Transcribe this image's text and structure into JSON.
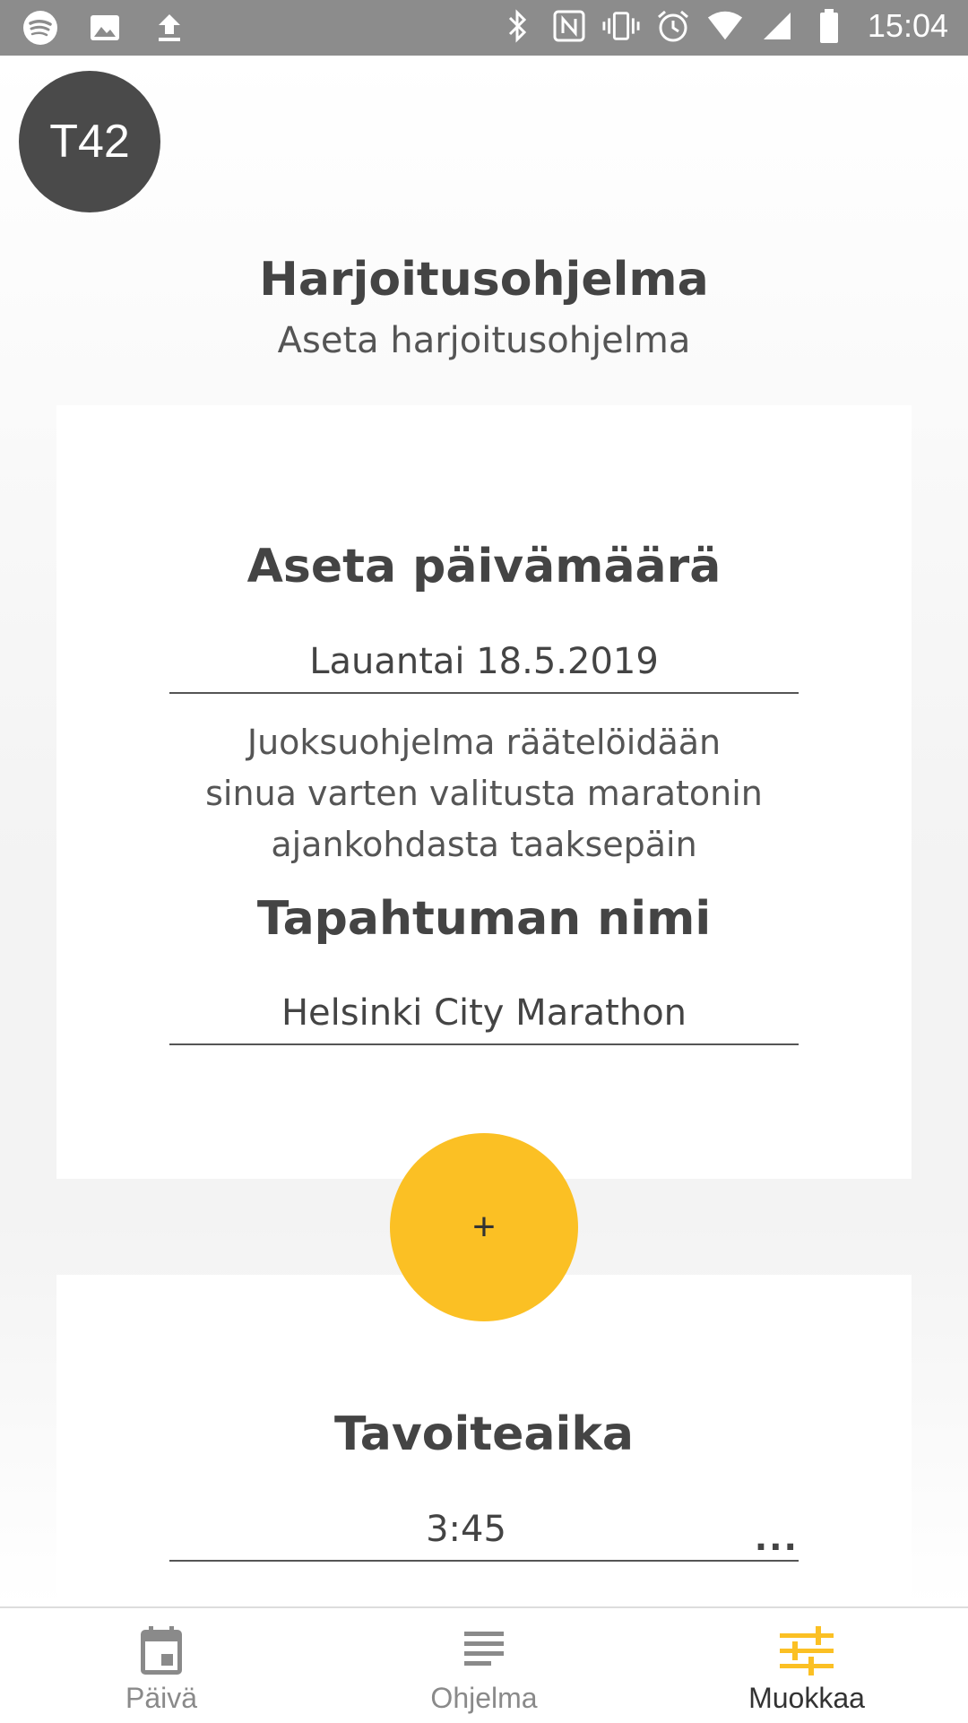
{
  "status_bar": {
    "time": "15:04",
    "left_icons": [
      "spotify-icon",
      "image-icon",
      "upload-icon"
    ],
    "right_icons": [
      "bluetooth-icon",
      "nfc-icon",
      "vibrate-icon",
      "alarm-icon",
      "wifi-icon",
      "signal-icon",
      "battery-icon"
    ]
  },
  "header": {
    "avatar_text": "T42",
    "title": "Harjoitusohjelma",
    "subtitle": "Aseta harjoitusohjelma"
  },
  "card1": {
    "date_heading": "Aseta päivämäärä",
    "date_value": "Lauantai 18.5.2019",
    "description_lines": [
      "Juoksuohjelma räätelöidään",
      "sinua varten valitusta maratonin",
      "ajankohdasta taaksepäin"
    ],
    "event_heading": "Tapahtuman nimi",
    "event_value": "Helsinki City Marathon"
  },
  "fab": {
    "label": "+"
  },
  "card2": {
    "goal_heading": "Tavoiteaika",
    "goal_value": "3:45",
    "more_label": "..."
  },
  "bottom_nav": {
    "items": [
      {
        "label": "Päivä",
        "icon": "calendar-icon",
        "active": false
      },
      {
        "label": "Ohjelma",
        "icon": "list-icon",
        "active": false
      },
      {
        "label": "Muokkaa",
        "icon": "sliders-icon",
        "active": true
      }
    ]
  },
  "colors": {
    "accent": "#fbc024",
    "status_bar": "#8c8c8c",
    "avatar": "#4a4a4a",
    "text": "#444444",
    "inactive_nav": "#8a8a8a"
  }
}
